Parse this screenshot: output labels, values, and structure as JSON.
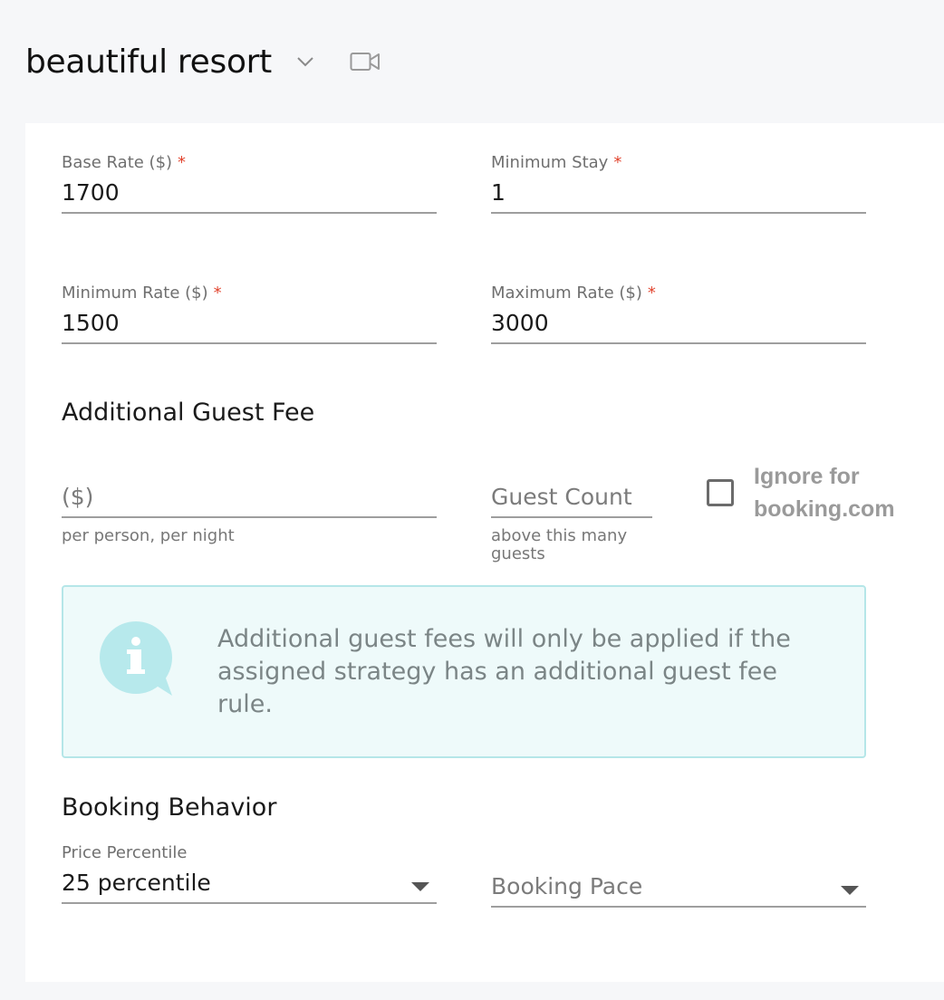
{
  "header": {
    "title": "beautiful resort",
    "icons": {
      "dropdown": "chevron-down-icon",
      "video": "video-camera-icon"
    }
  },
  "rates": {
    "base_rate": {
      "label": "Base Rate ($)",
      "required": "*",
      "value": "1700"
    },
    "minimum_stay": {
      "label": "Minimum Stay",
      "required": "*",
      "value": "1"
    },
    "minimum_rate": {
      "label": "Minimum Rate ($)",
      "required": "*",
      "value": "1500"
    },
    "maximum_rate": {
      "label": "Maximum Rate ($)",
      "required": "*",
      "value": "3000"
    }
  },
  "guest_fee": {
    "title": "Additional Guest Fee",
    "fee": {
      "placeholder": "($)",
      "helper": "per person, per night"
    },
    "guest_count": {
      "placeholder": "Guest Count",
      "helper": "above this many guests"
    },
    "ignore_checkbox": {
      "label": "Ignore for booking.com",
      "checked": false
    },
    "info": {
      "icon": "info-speech-bubble-icon",
      "text": "Additional guest fees will only be applied if the assigned strategy has an additional guest fee rule."
    }
  },
  "booking_behavior": {
    "title": "Booking Behavior",
    "price_percentile": {
      "label": "Price Percentile",
      "value": "25 percentile"
    },
    "booking_pace": {
      "placeholder": "Booking Pace"
    }
  },
  "colors": {
    "required": "#e2452f",
    "info_bg": "#eefafa",
    "info_border": "#b5e6e8",
    "info_icon": "#b7e9ec"
  }
}
